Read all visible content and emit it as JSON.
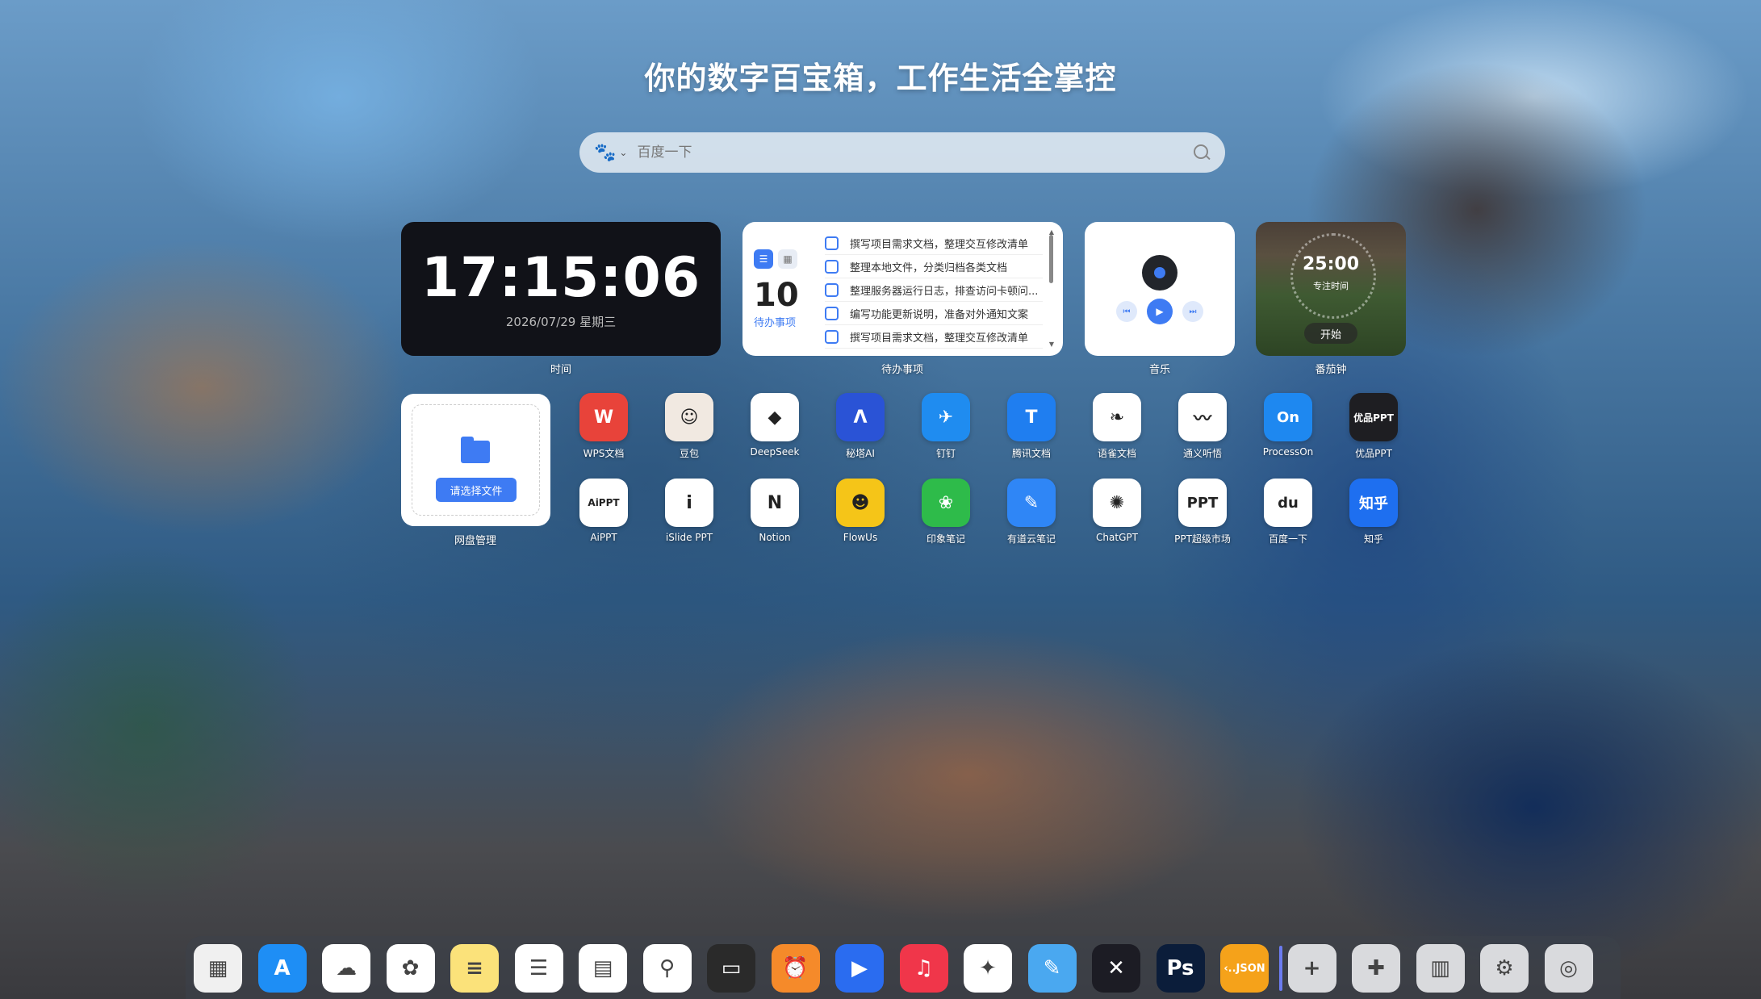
{
  "headline": "你的数字百宝箱，工作生活全掌控",
  "search": {
    "placeholder": "百度一下",
    "engine_icon": "baidu-paw-icon"
  },
  "clock": {
    "time": "17:15:06",
    "date": "2026/07/29 星期三",
    "label": "时间"
  },
  "todo": {
    "count": "10",
    "count_label": "待办事项",
    "label": "待办事项",
    "items": [
      "撰写项目需求文档，整理交互修改清单",
      "整理本地文件，分类归档各类文档",
      "整理服务器运行日志，排查访问卡顿问...",
      "编写功能更新说明，准备对外通知文案",
      "撰写项目需求文档，整理交互修改清单"
    ]
  },
  "music": {
    "label": "音乐"
  },
  "pomodoro": {
    "time": "25:00",
    "subtitle": "专注时间",
    "start": "开始",
    "label": "番茄钟"
  },
  "disk": {
    "button": "请选择文件",
    "label": "网盘管理"
  },
  "apps": [
    {
      "name": "WPS文档",
      "glyph": "W",
      "bg": "#e8433a"
    },
    {
      "name": "豆包",
      "glyph": "☺",
      "bg": "#f1e9e1"
    },
    {
      "name": "DeepSeek",
      "glyph": "◆",
      "bg": "#ffffff"
    },
    {
      "name": "秘塔AI",
      "glyph": "Λ",
      "bg": "#2a53d6"
    },
    {
      "name": "钉钉",
      "glyph": "✈",
      "bg": "#1f8cf0"
    },
    {
      "name": "腾讯文档",
      "glyph": "T",
      "bg": "#1f7ef0"
    },
    {
      "name": "语雀文档",
      "glyph": "❧",
      "bg": "#ffffff"
    },
    {
      "name": "通义听悟",
      "glyph": "〰",
      "bg": "#ffffff"
    },
    {
      "name": "ProcessOn",
      "glyph": "On",
      "bg": "#1e88f0"
    },
    {
      "name": "优品PPT",
      "glyph": "优品PPT",
      "bg": "#1e1e22"
    },
    {
      "name": "AiPPT",
      "glyph": "AiPPT",
      "bg": "#ffffff"
    },
    {
      "name": "iSlide PPT",
      "glyph": "i",
      "bg": "#ffffff"
    },
    {
      "name": "Notion",
      "glyph": "N",
      "bg": "#ffffff"
    },
    {
      "name": "FlowUs",
      "glyph": "☻",
      "bg": "#f5c518"
    },
    {
      "name": "印象笔记",
      "glyph": "❀",
      "bg": "#2ebb4a"
    },
    {
      "name": "有道云笔记",
      "glyph": "✎",
      "bg": "#2f86f6"
    },
    {
      "name": "ChatGPT",
      "glyph": "✺",
      "bg": "#ffffff"
    },
    {
      "name": "PPT超级市场",
      "glyph": "PPT",
      "bg": "#ffffff"
    },
    {
      "name": "百度一下",
      "glyph": "du",
      "bg": "#ffffff"
    },
    {
      "name": "知乎",
      "glyph": "知乎",
      "bg": "#1e6ff0"
    }
  ],
  "dock": [
    {
      "name": "launchpad-icon",
      "glyph": "▦",
      "bg": "#f0f0f0"
    },
    {
      "name": "app-store-icon",
      "glyph": "A",
      "bg": "#1e8ef5"
    },
    {
      "name": "icloud-icon",
      "glyph": "☁",
      "bg": "#ffffff"
    },
    {
      "name": "photos-icon",
      "glyph": "✿",
      "bg": "#ffffff"
    },
    {
      "name": "notes-icon",
      "glyph": "≡",
      "bg": "#fbe27a"
    },
    {
      "name": "reminders-icon",
      "glyph": "☰",
      "bg": "#ffffff"
    },
    {
      "name": "calendar-icon",
      "glyph": "▤",
      "bg": "#ffffff"
    },
    {
      "name": "maps-icon",
      "glyph": "⚲",
      "bg": "#ffffff"
    },
    {
      "name": "wallet-icon",
      "glyph": "▭",
      "bg": "#2a2a2a"
    },
    {
      "name": "clock-icon",
      "glyph": "⏰",
      "bg": "#f58a2a"
    },
    {
      "name": "player-icon",
      "glyph": "▶",
      "bg": "#2a6cf0"
    },
    {
      "name": "music-icon",
      "glyph": "♫",
      "bg": "#f0364a"
    },
    {
      "name": "safari-icon",
      "glyph": "✦",
      "bg": "#ffffff"
    },
    {
      "name": "pencil-icon",
      "glyph": "✎",
      "bg": "#4aa8f0"
    },
    {
      "name": "network-icon",
      "glyph": "✕",
      "bg": "#1c1c24"
    },
    {
      "name": "photoshop-icon",
      "glyph": "Ps",
      "bg": "#0b1d3a"
    },
    {
      "name": "json-icon",
      "glyph": "‹..JSON",
      "bg": "#f5a21a"
    },
    {
      "name": "add-icon",
      "glyph": "+",
      "bg": "#d9dadd"
    },
    {
      "name": "puzzle-icon",
      "glyph": "✚",
      "bg": "#d9dadd"
    },
    {
      "name": "brush-icon",
      "glyph": "▥",
      "bg": "#d9dadd"
    },
    {
      "name": "settings-gear-icon",
      "glyph": "⚙",
      "bg": "#d9dadd"
    },
    {
      "name": "system-settings-icon",
      "glyph": "◎",
      "bg": "#d9dadd"
    }
  ]
}
